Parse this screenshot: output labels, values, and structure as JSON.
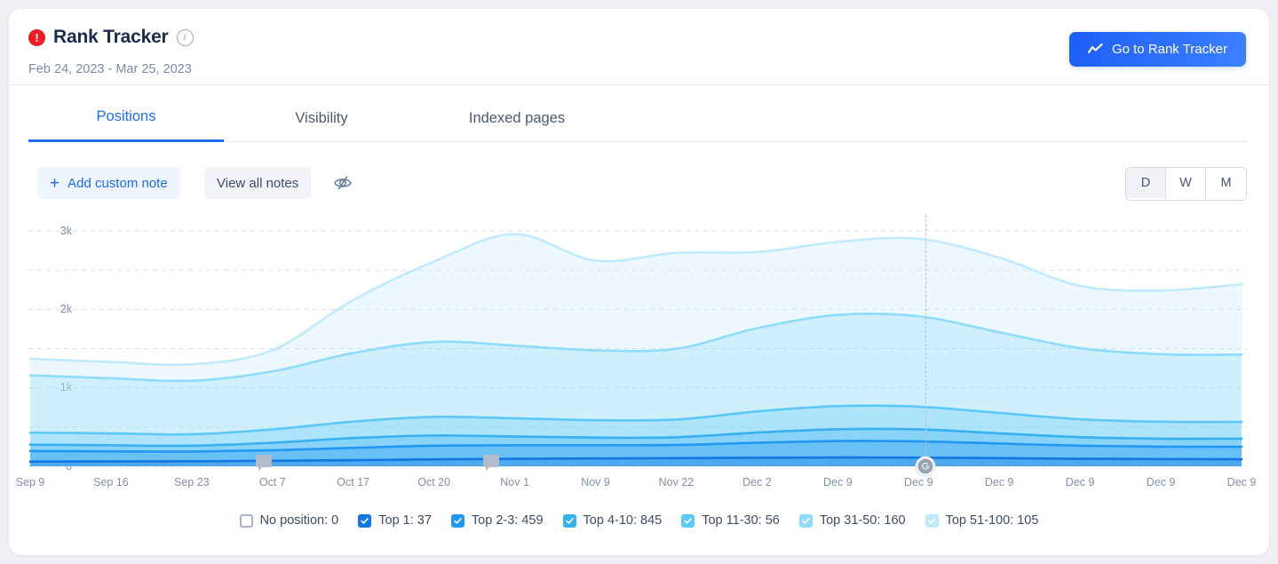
{
  "header": {
    "alert_icon": "alert-exclamation-icon",
    "title": "Rank Tracker",
    "info_icon": "info-icon",
    "date_range": "Feb 24, 2023 - Mar 25, 2023",
    "cta": {
      "label": "Go to Rank Tracker",
      "icon": "line-chart-icon"
    }
  },
  "tabs": [
    {
      "label": "Positions",
      "active": true
    },
    {
      "label": "Visibility",
      "active": false
    },
    {
      "label": "Indexed pages",
      "active": false
    }
  ],
  "toolbar": {
    "add_note_label": "Add custom note",
    "add_note_icon": "plus-icon",
    "view_notes_label": "View all notes",
    "hide_notes_icon": "eye-off-icon",
    "periods": [
      {
        "label": "D",
        "selected": true
      },
      {
        "label": "W",
        "selected": false
      },
      {
        "label": "M",
        "selected": false
      }
    ]
  },
  "colors": {
    "accent": "#1a6cf2",
    "alert": "#ec1c24",
    "top1": "#1277e0",
    "top2_3": "#2196f3",
    "top4_10": "#35b0f0",
    "top11_30": "#5cc8f7",
    "top31_50": "#8ddcfb",
    "top51_100": "#bfe9fd",
    "no_position": "#ffffff",
    "grid": "#d9dee6"
  },
  "chart_data": {
    "type": "area",
    "title": "",
    "xlabel": "",
    "ylabel": "",
    "ylim": [
      0,
      3000
    ],
    "yticks": [
      0,
      1000,
      2000,
      3000
    ],
    "ytick_labels": [
      "0",
      "1k",
      "2k",
      "3k"
    ],
    "grid": true,
    "gridlines": [
      0,
      500,
      1000,
      1500,
      2000,
      2500,
      3000
    ],
    "legend_position": "bottom",
    "stacked": true,
    "x": [
      "Sep 9",
      "Sep 16",
      "Sep 23",
      "Oct 7",
      "Oct 17",
      "Oct 20",
      "Nov 1",
      "Nov 9",
      "Nov 22",
      "Dec 2",
      "Dec 9",
      "Dec 9",
      "Dec 9",
      "Dec 9",
      "Dec 9",
      "Dec 9"
    ],
    "tick_labels": [
      "Sep 9",
      "Sep 16",
      "Sep 23",
      "Oct 7",
      "Oct 17",
      "Oct 20",
      "Nov 1",
      "Nov 9",
      "Nov 22",
      "Dec 2",
      "Dec 9",
      "Dec 9",
      "Dec 9",
      "Dec 9",
      "Dec 9",
      "Dec 9"
    ],
    "series": [
      {
        "name": "Top 1",
        "total": 37,
        "color": "#1277e0",
        "checked": true,
        "values": [
          60,
          62,
          64,
          70,
          78,
          88,
          96,
          100,
          104,
          108,
          112,
          110,
          104,
          96,
          92,
          90
        ]
      },
      {
        "name": "Top 2-3",
        "total": 459,
        "color": "#2196f3",
        "checked": true,
        "values": [
          195,
          190,
          188,
          205,
          235,
          262,
          268,
          268,
          272,
          300,
          322,
          318,
          290,
          262,
          250,
          248
        ]
      },
      {
        "name": "Top 4-10",
        "total": 845,
        "color": "#35b0f0",
        "checked": true,
        "values": [
          275,
          268,
          262,
          300,
          360,
          392,
          380,
          366,
          370,
          430,
          472,
          470,
          420,
          372,
          352,
          352
        ]
      },
      {
        "name": "Top 11-30",
        "total": 56,
        "color": "#5cc8f7",
        "checked": true,
        "values": [
          430,
          420,
          408,
          470,
          570,
          630,
          612,
          588,
          596,
          700,
          768,
          760,
          680,
          600,
          568,
          566
        ]
      },
      {
        "name": "Top 31-50",
        "total": 160,
        "color": "#8ddcfb",
        "checked": true,
        "values": [
          1160,
          1122,
          1090,
          1210,
          1444,
          1586,
          1538,
          1478,
          1498,
          1760,
          1930,
          1912,
          1708,
          1506,
          1428,
          1424
        ]
      },
      {
        "name": "Top 51-100",
        "total": 105,
        "color": "#bfe9fd",
        "checked": true,
        "values": [
          1370,
          1330,
          1300,
          1480,
          2120,
          2610,
          2960,
          2620,
          2720,
          2730,
          2860,
          2900,
          2660,
          2300,
          2240,
          2320
        ]
      },
      {
        "name": "No position",
        "total": 0,
        "color": "#ffffff",
        "checked": false,
        "values": [
          0,
          0,
          0,
          0,
          0,
          0,
          0,
          0,
          0,
          0,
          0,
          0,
          0,
          0,
          0,
          0
        ]
      }
    ],
    "legend": [
      {
        "label": "No position: 0",
        "checked": false,
        "color": "#ffffff"
      },
      {
        "label": "Top 1: 37",
        "checked": true,
        "color": "#1277e0"
      },
      {
        "label": "Top 2-3: 459",
        "checked": true,
        "color": "#2196f3"
      },
      {
        "label": "Top 4-10: 845",
        "checked": true,
        "color": "#35b0f0"
      },
      {
        "label": "Top 11-30: 56",
        "checked": true,
        "color": "#5cc8f7"
      },
      {
        "label": "Top 31-50: 160",
        "checked": true,
        "color": "#8ddcfb"
      },
      {
        "label": "Top 51-100: 105",
        "checked": true,
        "color": "#bfe9fd"
      }
    ],
    "annotations": [
      {
        "type": "note-marker",
        "x_label": "Sep 23"
      },
      {
        "type": "note-marker",
        "x_label": "Oct 20"
      },
      {
        "type": "event-marker",
        "label": "G",
        "x_label": "Dec 9"
      }
    ]
  }
}
